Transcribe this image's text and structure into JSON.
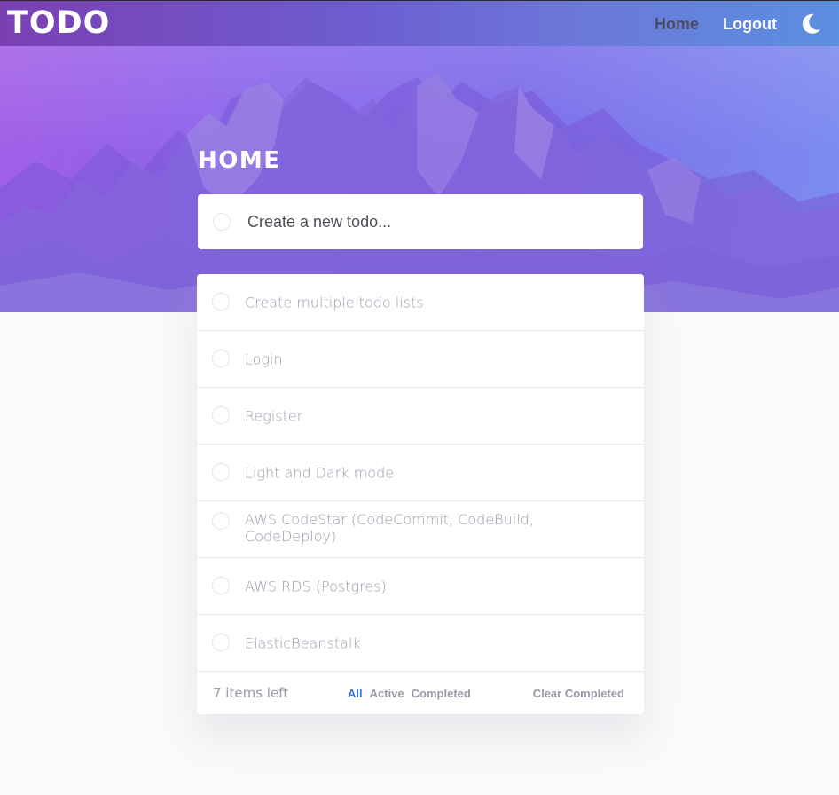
{
  "app": {
    "logo": "TODO"
  },
  "nav": {
    "home_label": "Home",
    "logout_label": "Logout",
    "theme_icon": "moon-icon"
  },
  "page": {
    "title": "HOME"
  },
  "new_todo": {
    "placeholder": "Create a new todo..."
  },
  "todos": [
    {
      "text": "Create multiple todo lists"
    },
    {
      "text": "Login"
    },
    {
      "text": "Register"
    },
    {
      "text": "Light and Dark mode"
    },
    {
      "text": "AWS CodeStar (CodeCommit, CodeBuild, CodeDeploy)"
    },
    {
      "text": "AWS RDS (Postgres)"
    },
    {
      "text": "ElasticBeanstalk"
    }
  ],
  "footer": {
    "items_left": "7 items left",
    "filters": [
      "All",
      "Active",
      "Completed"
    ],
    "active_filter": "All",
    "clear_completed": "Clear Completed"
  },
  "colors": {
    "accent": "#3a7bd5",
    "nav_gradient_start": "#7a3fb3",
    "nav_gradient_end": "#5b8fdf",
    "todo_text": "#9a9aac"
  }
}
